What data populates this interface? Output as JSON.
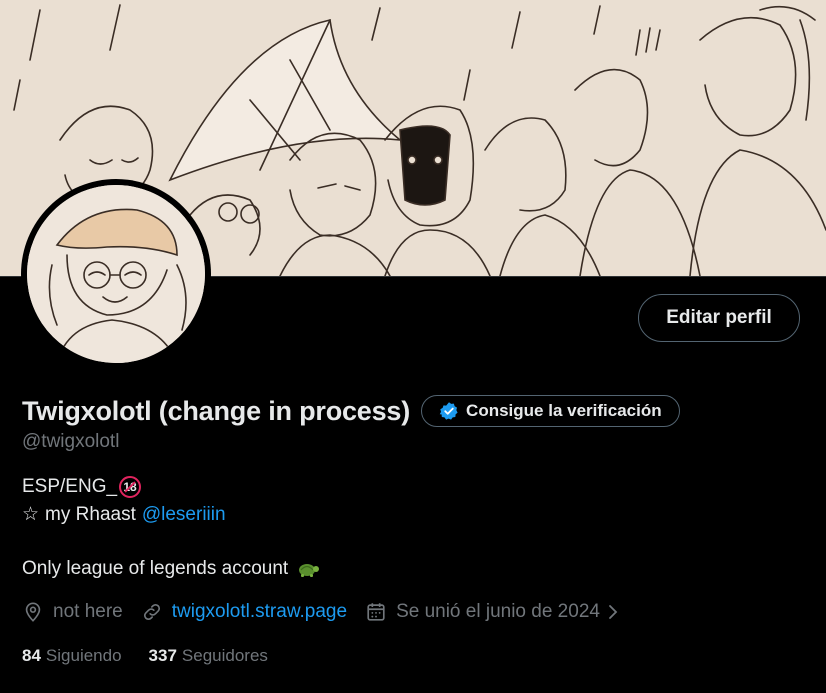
{
  "header": {
    "banner_icon": "manga-sketch-banner-image",
    "avatar_icon": "sketched-avatar-image"
  },
  "actions": {
    "edit_profile_label": "Editar perfil"
  },
  "profile": {
    "display_name": "Twigxolotl (change in process)",
    "verify_label": "Consigue la verificación",
    "handle": "@twigxolotl",
    "bio": {
      "line1": "ESP/ENG_",
      "badge": "18",
      "line2_prefix": "my Rhaast",
      "star": "☆",
      "mention": "@leseriiin",
      "line3": "Only league of legends account"
    },
    "meta": {
      "location": "not here",
      "website": "twigxolotl.straw.page",
      "joined": "Se unió el junio de 2024"
    },
    "following_count": "84",
    "following_label": "Siguiendo",
    "followers_count": "337",
    "followers_label": "Seguidores"
  },
  "colors": {
    "background": "#000000",
    "text_primary": "#e7e9ea",
    "text_secondary": "#71767b",
    "accent": "#1d9bf0",
    "border": "#536471"
  }
}
